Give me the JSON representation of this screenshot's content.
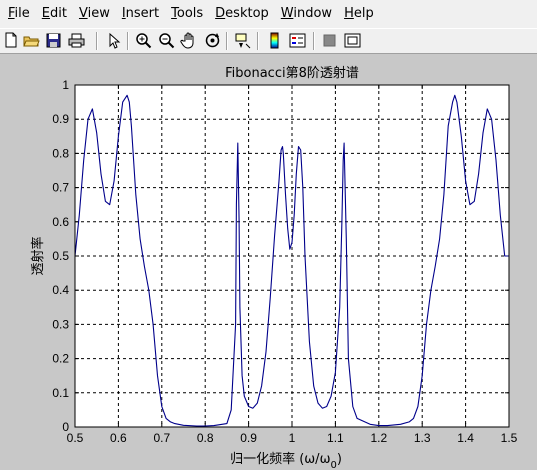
{
  "menu": [
    {
      "key": "F",
      "rest": "ile"
    },
    {
      "key": "E",
      "rest": "dit"
    },
    {
      "key": "V",
      "rest": "iew"
    },
    {
      "key": "I",
      "rest": "nsert"
    },
    {
      "key": "T",
      "rest": "ools"
    },
    {
      "key": "D",
      "rest": "esktop"
    },
    {
      "key": "W",
      "rest": "indow"
    },
    {
      "key": "H",
      "rest": "elp"
    }
  ],
  "toolbar_icons": [
    "new-figure-icon",
    "open-file-icon",
    "save-icon",
    "print-icon",
    "edit-plot-arrow-icon",
    "zoom-in-icon",
    "zoom-out-icon",
    "pan-hand-icon",
    "rotate-3d-icon",
    "data-cursor-icon",
    "colorbar-icon",
    "legend-icon",
    "hide-plot-tools-icon",
    "show-plot-tools-icon"
  ],
  "chart_data": {
    "type": "line",
    "title": "Fibonacci第8阶透射谱",
    "xlabel_main": "归一化频率 (ω/ω",
    "xlabel_sub": "0",
    "xlabel_end": ")",
    "ylabel": "透射率",
    "xlim": [
      0.5,
      1.5
    ],
    "ylim": [
      0,
      1
    ],
    "xticks": [
      "0.5",
      "0.6",
      "0.7",
      "0.8",
      "0.9",
      "1",
      "1.1",
      "1.2",
      "1.3",
      "1.4",
      "1.5"
    ],
    "yticks": [
      "0",
      "0.1",
      "0.2",
      "0.3",
      "0.4",
      "0.5",
      "0.6",
      "0.7",
      "0.8",
      "0.9",
      "1"
    ],
    "grid": "on",
    "line_color": "#00008b",
    "series": [
      {
        "x": [
          0.5,
          0.51,
          0.52,
          0.53,
          0.54,
          0.55,
          0.56,
          0.57,
          0.58,
          0.59,
          0.6,
          0.61,
          0.62,
          0.625,
          0.63,
          0.64,
          0.65,
          0.66,
          0.67,
          0.68,
          0.69,
          0.7,
          0.71,
          0.72,
          0.73,
          0.75,
          0.78,
          0.8,
          0.82,
          0.85,
          0.86,
          0.87,
          0.872,
          0.875,
          0.878,
          0.88,
          0.885,
          0.89,
          0.9,
          0.91,
          0.92,
          0.93,
          0.94,
          0.95,
          0.96,
          0.97,
          0.975,
          0.978,
          0.98,
          0.985,
          0.99,
          0.995,
          1.0,
          1.005,
          1.01,
          1.015,
          1.02,
          1.025,
          1.03,
          1.04,
          1.05,
          1.06,
          1.07,
          1.08,
          1.09,
          1.1,
          1.11,
          1.115,
          1.118,
          1.12,
          1.125,
          1.13,
          1.14,
          1.15,
          1.18,
          1.2,
          1.22,
          1.25,
          1.27,
          1.28,
          1.29,
          1.3,
          1.31,
          1.32,
          1.33,
          1.34,
          1.35,
          1.36,
          1.37,
          1.375,
          1.38,
          1.39,
          1.4,
          1.41,
          1.42,
          1.43,
          1.44,
          1.45,
          1.46,
          1.47,
          1.48,
          1.49,
          1.5
        ],
        "y": [
          0.5,
          0.62,
          0.78,
          0.9,
          0.93,
          0.86,
          0.74,
          0.66,
          0.65,
          0.72,
          0.85,
          0.95,
          0.97,
          0.95,
          0.88,
          0.68,
          0.55,
          0.47,
          0.4,
          0.3,
          0.15,
          0.06,
          0.025,
          0.015,
          0.01,
          0.005,
          0.003,
          0.003,
          0.004,
          0.01,
          0.05,
          0.3,
          0.65,
          0.83,
          0.6,
          0.35,
          0.15,
          0.09,
          0.06,
          0.055,
          0.07,
          0.12,
          0.22,
          0.38,
          0.56,
          0.72,
          0.81,
          0.82,
          0.8,
          0.68,
          0.58,
          0.52,
          0.54,
          0.62,
          0.74,
          0.82,
          0.81,
          0.7,
          0.5,
          0.25,
          0.12,
          0.07,
          0.055,
          0.06,
          0.09,
          0.16,
          0.35,
          0.6,
          0.78,
          0.83,
          0.55,
          0.2,
          0.06,
          0.025,
          0.008,
          0.004,
          0.004,
          0.008,
          0.015,
          0.025,
          0.06,
          0.15,
          0.3,
          0.4,
          0.47,
          0.55,
          0.68,
          0.88,
          0.95,
          0.97,
          0.95,
          0.85,
          0.72,
          0.65,
          0.66,
          0.74,
          0.86,
          0.93,
          0.9,
          0.78,
          0.62,
          0.5,
          0.5
        ]
      }
    ]
  }
}
